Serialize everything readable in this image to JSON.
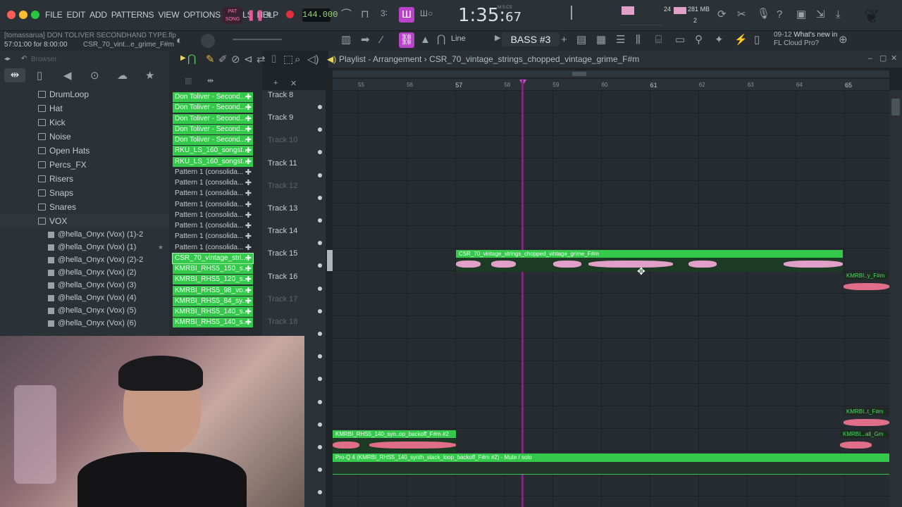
{
  "menu": [
    "FILE",
    "EDIT",
    "ADD",
    "PATTERNS",
    "VIEW",
    "OPTIONS",
    "TOOLS",
    "HELP"
  ],
  "transport": {
    "mode_top": "PAT",
    "mode_bottom": "SONG",
    "tempo": "144.000",
    "time_main": "1:35:",
    "time_small": "67",
    "time_unit": "M:S:CS"
  },
  "status": {
    "memory": "281 MB",
    "cpu": "24",
    "poly": "2"
  },
  "hint": {
    "project": "[tomassarua] DON TOLIVER SECONDHAND TYPE.flp",
    "position": "57:01:00 for 8:00:00",
    "sample": "CSR_70_vint...e_grime_F#m"
  },
  "toolbar": {
    "snap": "Line",
    "pattern": "BASS #3"
  },
  "news": {
    "date": "09-12",
    "title": "What's new in",
    "subtitle": "FL Cloud Pro?"
  },
  "browser": {
    "title": "Browser",
    "folders": [
      "DrumLoop",
      "Hat",
      "Kick",
      "Noise",
      "Open Hats",
      "Percs_FX",
      "Risers",
      "Snaps",
      "Snares",
      "VOX"
    ],
    "files": [
      "@hella_Onyx (Vox) (1)-2",
      "@hella_Onyx (Vox) (1)",
      "@hella_Onyx (Vox) (2)-2",
      "@hella_Onyx (Vox) (2)",
      "@hella_Onyx (Vox) (3)",
      "@hella_Onyx (Vox) (4)",
      "@hella_Onyx (Vox) (5)",
      "@hella_Onyx (Vox) (6)"
    ]
  },
  "channels": [
    {
      "name": "Don Toliver - Second...",
      "green": true
    },
    {
      "name": "Don Toliver - Second...",
      "green": true
    },
    {
      "name": "Don Toliver - Second...",
      "green": true
    },
    {
      "name": "Don Toliver - Second...",
      "green": true
    },
    {
      "name": "Don Toliver - Second...",
      "green": true
    },
    {
      "name": "RKU_LS_160_songst...",
      "green": true
    },
    {
      "name": "RKU_LS_160_songst...",
      "green": true
    },
    {
      "name": "Pattern 1 (consolida...",
      "green": false
    },
    {
      "name": "Pattern 1 (consolida...",
      "green": false
    },
    {
      "name": "Pattern 1 (consolida...",
      "green": false
    },
    {
      "name": "Pattern 1 (consolida...",
      "green": false
    },
    {
      "name": "Pattern 1 (consolida...",
      "green": false
    },
    {
      "name": "Pattern 1 (consolida...",
      "green": false
    },
    {
      "name": "Pattern 1 (consolida...",
      "green": false
    },
    {
      "name": "Pattern 1 (consolida...",
      "green": false
    },
    {
      "name": "CSR_70_vintage_stri...",
      "green": true
    },
    {
      "name": "KMRBI_RHS5_150_s...",
      "green": true
    },
    {
      "name": "KMRBI_RHS5_120_s...",
      "green": true
    },
    {
      "name": "KMRBI_RHS5_98_vo...",
      "green": true
    },
    {
      "name": "KMRBI_RHS5_84_sy...",
      "green": true
    },
    {
      "name": "KMRBI_RHS5_140_s...",
      "green": true
    },
    {
      "name": "KMRBI_RHS5_140_s...",
      "green": true
    }
  ],
  "tracks": [
    {
      "label": "Track 8",
      "dim": false
    },
    {
      "label": "Track 9",
      "dim": false
    },
    {
      "label": "Track 10",
      "dim": true
    },
    {
      "label": "Track 11",
      "dim": false
    },
    {
      "label": "Track 12",
      "dim": true
    },
    {
      "label": "Track 13",
      "dim": false
    },
    {
      "label": "Track 14",
      "dim": false
    },
    {
      "label": "Track 15",
      "dim": false
    },
    {
      "label": "Track 16",
      "dim": false
    },
    {
      "label": "Track 17",
      "dim": true
    },
    {
      "label": "Track 18",
      "dim": true
    }
  ],
  "playlist": {
    "title": "Playlist - Arrangement",
    "separator": "›",
    "pattern": "CSR_70_vintage_strings_chopped_vintage_grime_F#m",
    "bars": [
      "55",
      "56",
      "57",
      "58",
      "59",
      "60",
      "61",
      "62",
      "63",
      "64",
      "65"
    ],
    "clips": {
      "main": "CSR_70_vintage_strings_chopped_vintage_grime_F#m",
      "right_top": "KMRBI..y_F#m",
      "right_mid": "KMRBI..t_F#m",
      "right_low": "KMRBI...all_Gm",
      "backoff": "KMRBI_RHS5_140_syn..op_backoff_F#m #2",
      "automation": "Pro-Q 4 (KMRBI_RHS5_140_synth_stack_loop_backoff_F#m #2) - Mute / solo"
    }
  },
  "colors": {
    "accent_green": "#34c94a",
    "playhead": "#7a2a7c",
    "wave": "#e0a0c8"
  }
}
